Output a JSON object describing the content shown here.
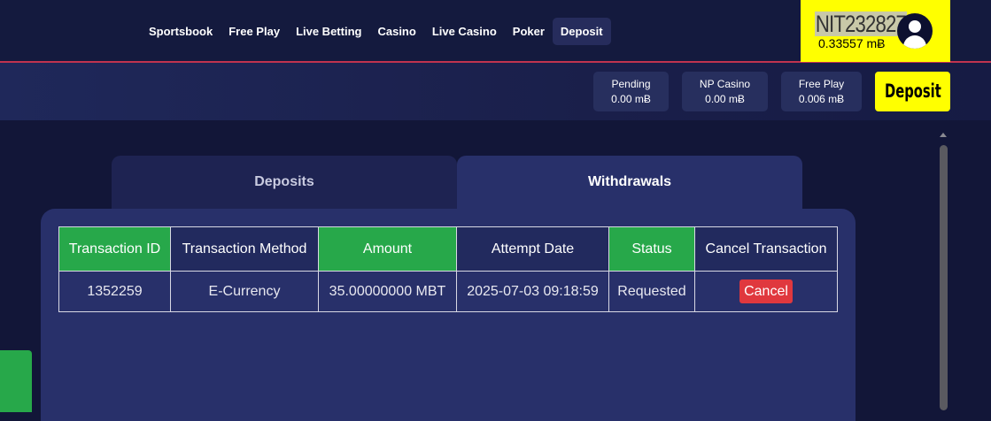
{
  "nav": {
    "items": [
      "Sportsbook",
      "Free Play",
      "Live Betting",
      "Casino",
      "Live Casino",
      "Poker",
      "Deposit"
    ],
    "active": "Deposit"
  },
  "account": {
    "id": "NIT232827",
    "balance": "0.33557 mɃ",
    "avatar_icon": "user-circle-icon"
  },
  "balances": {
    "pending": {
      "label": "Pending",
      "value": "0.00 mɃ"
    },
    "np_casino": {
      "label": "NP Casino",
      "value": "0.00 mɃ"
    },
    "free_play": {
      "label": "Free Play",
      "value": "0.006 mɃ"
    },
    "deposit_label": "Deposit"
  },
  "tabs": {
    "deposits": "Deposits",
    "withdrawals": "Withdrawals",
    "active": "Withdrawals"
  },
  "table": {
    "headers": [
      "Transaction ID",
      "Transaction Method",
      "Amount",
      "Attempt Date",
      "Status",
      "Cancel Transaction"
    ],
    "rows": [
      {
        "transaction_id": "1352259",
        "method": "E-Currency",
        "amount": "35.00000000 MBT",
        "attempt_date": "2025-07-03 09:18:59",
        "status": "Requested",
        "action": "Cancel"
      }
    ]
  },
  "colors": {
    "accent_yellow": "#ffff00",
    "header_green": "#27a84a",
    "cancel_red": "#e0383e",
    "nav_border": "#c0334f"
  }
}
